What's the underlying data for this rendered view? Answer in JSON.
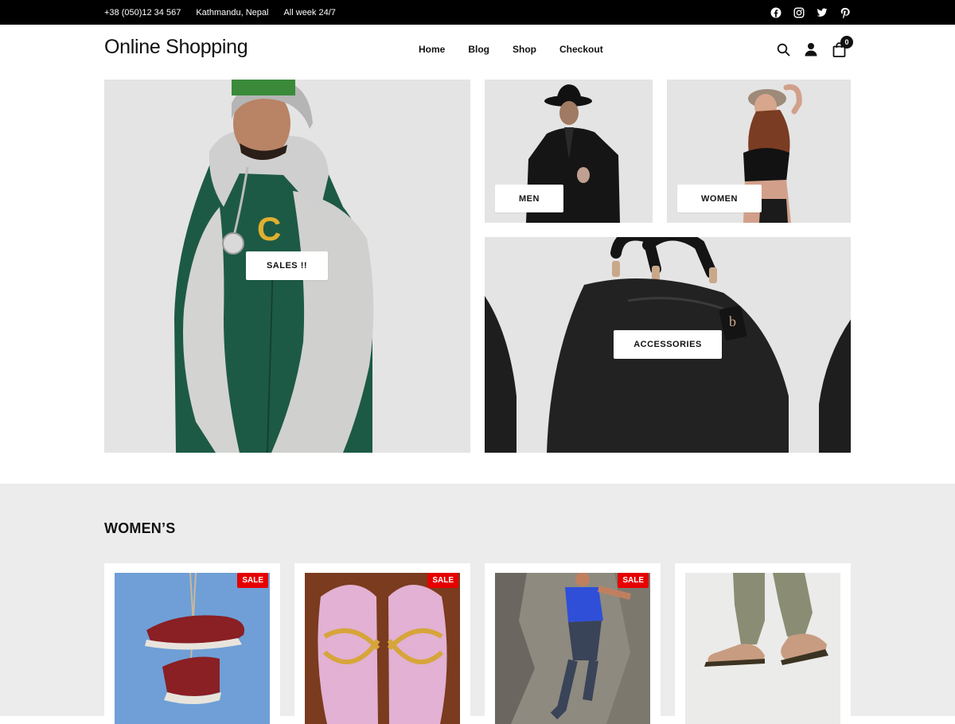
{
  "topbar": {
    "phone": "+38 (050)12 34 567",
    "location": "Kathmandu, Nepal",
    "hours": "All week 24/7",
    "social": [
      "facebook-icon",
      "instagram-icon",
      "twitter-icon",
      "pinterest-icon"
    ]
  },
  "header": {
    "logo": "Online Shopping",
    "nav": [
      "Home",
      "Blog",
      "Shop",
      "Checkout"
    ],
    "icons": [
      "search-icon",
      "user-icon",
      "cart-icon"
    ],
    "cart_count": "0"
  },
  "banners": {
    "sales": "SALES !!",
    "men": "MEN",
    "women": "WOMEN",
    "accessories": "ACCESSORIES"
  },
  "womens": {
    "title": "WOMEN’S",
    "products": [
      {
        "badge": "SALE"
      },
      {
        "badge": "SALE"
      },
      {
        "badge": "SALE"
      },
      {
        "badge": ""
      }
    ]
  },
  "colors": {
    "topbar_bg": "#000000",
    "tile_bg": "#e4e4e4",
    "section_bg": "#ececec",
    "sale_badge": "#e60000"
  }
}
